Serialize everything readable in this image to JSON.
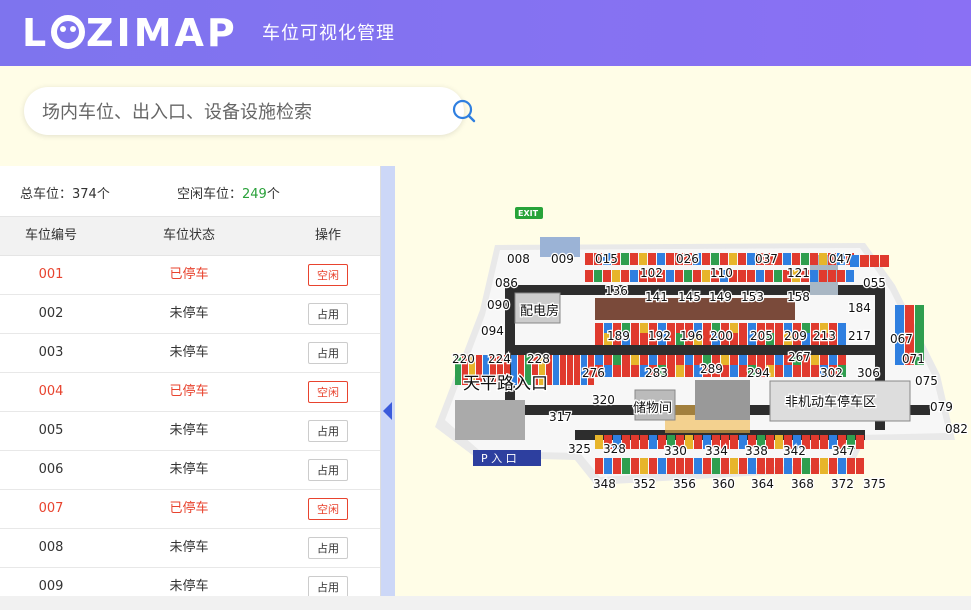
{
  "header": {
    "logo": "LOZIMAP",
    "title": "车位可视化管理"
  },
  "search": {
    "placeholder": "场内车位、出入口、设备设施检索"
  },
  "stats": {
    "total_label": "总车位：",
    "total_value": "374",
    "total_unit": "个",
    "free_label": "空闲车位：",
    "free_value": "249",
    "free_unit": "个"
  },
  "table": {
    "headers": [
      "车位编号",
      "车位状态",
      "操作"
    ],
    "rows": [
      {
        "id": "001",
        "status": "已停车",
        "action": "空闲"
      },
      {
        "id": "002",
        "status": "未停车",
        "action": "占用"
      },
      {
        "id": "003",
        "status": "未停车",
        "action": "占用"
      },
      {
        "id": "004",
        "status": "已停车",
        "action": "空闲"
      },
      {
        "id": "005",
        "status": "未停车",
        "action": "占用"
      },
      {
        "id": "006",
        "status": "未停车",
        "action": "占用"
      },
      {
        "id": "007",
        "status": "已停车",
        "action": "空闲"
      },
      {
        "id": "008",
        "status": "未停车",
        "action": "占用"
      },
      {
        "id": "009",
        "status": "未停车",
        "action": "占用"
      }
    ]
  },
  "map": {
    "exit_label": "EXIT",
    "entrance_label": "P 入 口",
    "rooms": {
      "power": "配电房",
      "storage": "储物间",
      "entrance_road": "天平路入口",
      "bike": "非机动车停车区"
    },
    "spot_labels": [
      "008",
      "009",
      "015",
      "026",
      "037",
      "047",
      "102",
      "110",
      "121",
      "086",
      "136",
      "141",
      "145",
      "149",
      "153",
      "158",
      "055",
      "090",
      "184",
      "094",
      "189",
      "192",
      "196",
      "200",
      "205",
      "209",
      "213",
      "217",
      "067",
      "220",
      "224",
      "228",
      "267",
      "071",
      "276",
      "283",
      "289",
      "294",
      "302",
      "306",
      "075",
      "320",
      "079",
      "317",
      "082",
      "325",
      "328",
      "330",
      "334",
      "338",
      "342",
      "347",
      "348",
      "352",
      "356",
      "360",
      "364",
      "368",
      "372",
      "375"
    ],
    "colors": {
      "occupied": "#e03a2e",
      "free": "#2f7fe0",
      "green": "#2f9e4f",
      "yellow": "#e7b52b",
      "road": "#2d2d2d",
      "floor": "#f7f7f7"
    }
  }
}
